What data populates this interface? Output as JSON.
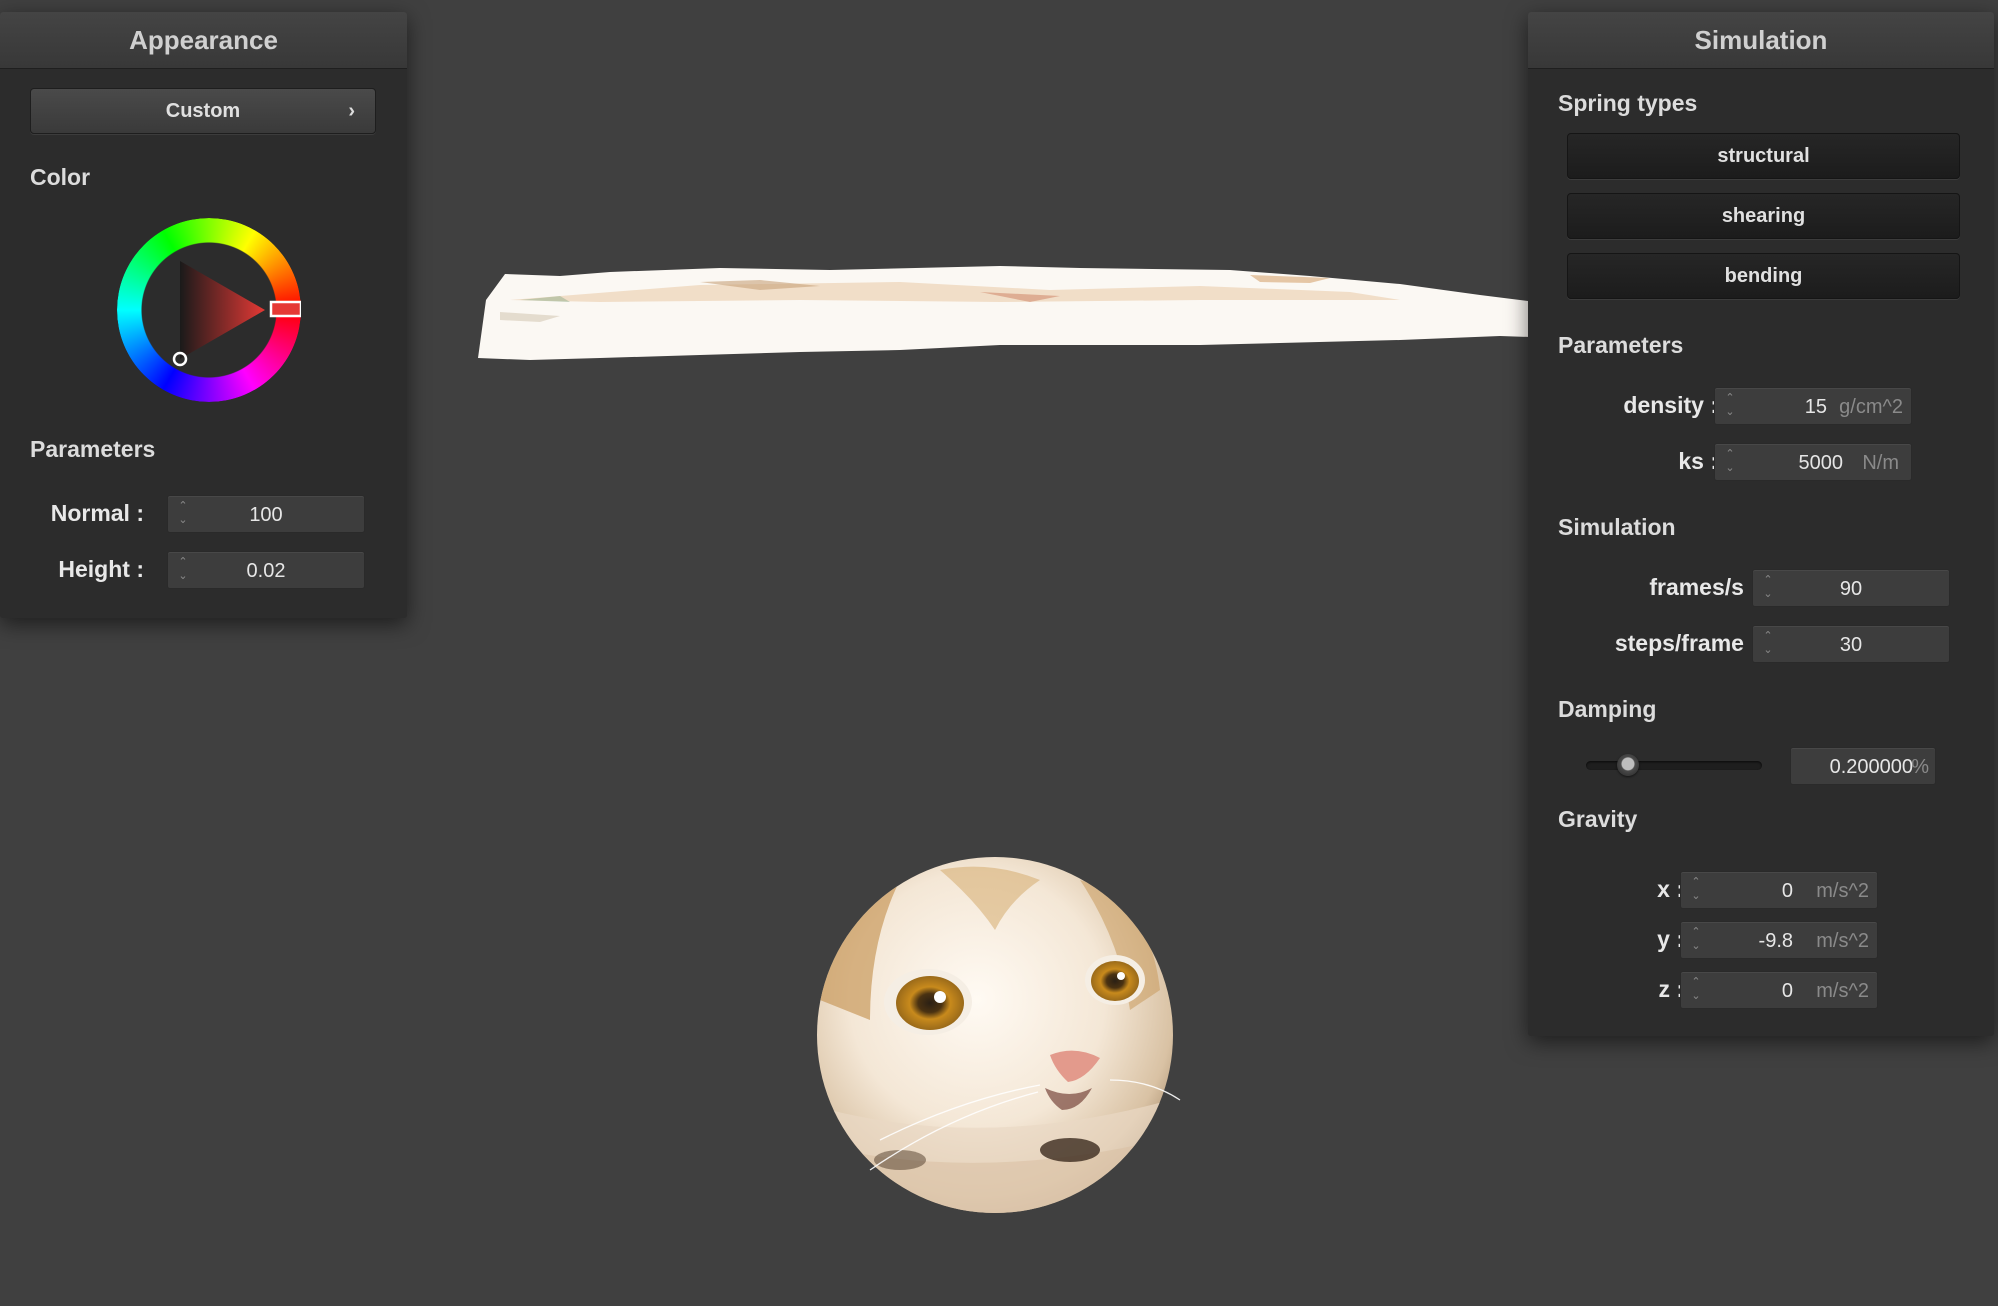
{
  "appearance": {
    "title": "Appearance",
    "preset_label": "Custom",
    "color_label": "Color",
    "parameters_label": "Parameters",
    "normal": {
      "label": "Normal :",
      "value": "100"
    },
    "height": {
      "label": "Height :",
      "value": "0.02"
    },
    "selected_color": "#e53935"
  },
  "simulation": {
    "title": "Simulation",
    "spring_types_label": "Spring types",
    "spring_types": [
      "structural",
      "shearing",
      "bending"
    ],
    "parameters_label": "Parameters",
    "density": {
      "label": "density :",
      "value": "15",
      "unit": "g/cm^2"
    },
    "ks": {
      "label": "ks :",
      "value": "5000",
      "unit": "N/m"
    },
    "simulation_label": "Simulation",
    "frames_per_s": {
      "label": "frames/s :",
      "value": "90"
    },
    "steps_per_frame": {
      "label": "steps/frame :",
      "value": "30"
    },
    "damping_label": "Damping",
    "damping": {
      "value": "0.200000",
      "unit": "%",
      "slider_fraction": 0.2
    },
    "gravity_label": "Gravity",
    "gravity": [
      {
        "label": "x :",
        "value": "0",
        "unit": "m/s^2"
      },
      {
        "label": "y :",
        "value": "-9.8",
        "unit": "m/s^2"
      },
      {
        "label": "z :",
        "value": "0",
        "unit": "m/s^2"
      }
    ]
  },
  "icons": {
    "chevron": "chevron-right-icon",
    "spin": "spin-arrows-icon"
  }
}
